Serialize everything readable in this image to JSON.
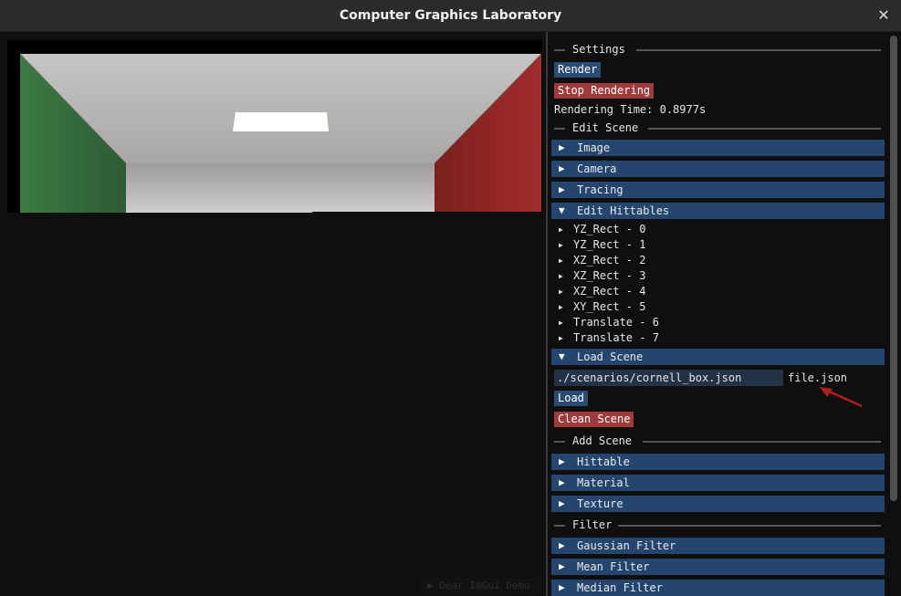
{
  "window": {
    "title": "Computer Graphics Laboratory",
    "close_glyph": "✕"
  },
  "viewport": {
    "demo_label": "▶ Dear ImGui Demo"
  },
  "settings": {
    "section": "Settings",
    "render_label": "Render",
    "stop_label": "Stop Rendering",
    "rendering_time": "Rendering Time: 0.8977s"
  },
  "edit_scene": {
    "section": "Edit Scene",
    "headers": [
      {
        "arrow": "▶",
        "label": "Image"
      },
      {
        "arrow": "▶",
        "label": "Camera"
      },
      {
        "arrow": "▶",
        "label": "Tracing"
      },
      {
        "arrow": "▼",
        "label": "Edit Hittables"
      }
    ],
    "hittables": [
      "YZ_Rect - 0",
      "YZ_Rect - 1",
      "XZ_Rect - 2",
      "XZ_Rect - 3",
      "XZ_Rect - 4",
      "XY_Rect - 5",
      "Translate - 6",
      "Translate - 7"
    ],
    "tree_arrow": "▶",
    "load_scene": {
      "arrow": "▼",
      "label": "Load Scene",
      "path_value": "./scenarios/cornell_box.json",
      "path_label": "file.json",
      "load_label": "Load",
      "clean_label": "Clean Scene"
    }
  },
  "add_scene": {
    "section": "Add Scene",
    "headers": [
      {
        "arrow": "▶",
        "label": "Hittable"
      },
      {
        "arrow": "▶",
        "label": "Material"
      },
      {
        "arrow": "▶",
        "label": "Texture"
      }
    ]
  },
  "filter": {
    "section": "Filter",
    "headers": [
      {
        "arrow": "▶",
        "label": "Gaussian Filter"
      },
      {
        "arrow": "▶",
        "label": "Mean Filter"
      },
      {
        "arrow": "▶",
        "label": "Median Filter"
      }
    ]
  },
  "colors": {
    "header_blue": "#24466e",
    "button_blue": "#2a4b72",
    "button_red": "#a13b3b",
    "annotation_arrow": "#b01e1e",
    "wall_green": "#3f7a45",
    "wall_red": "#9a2a2a"
  }
}
